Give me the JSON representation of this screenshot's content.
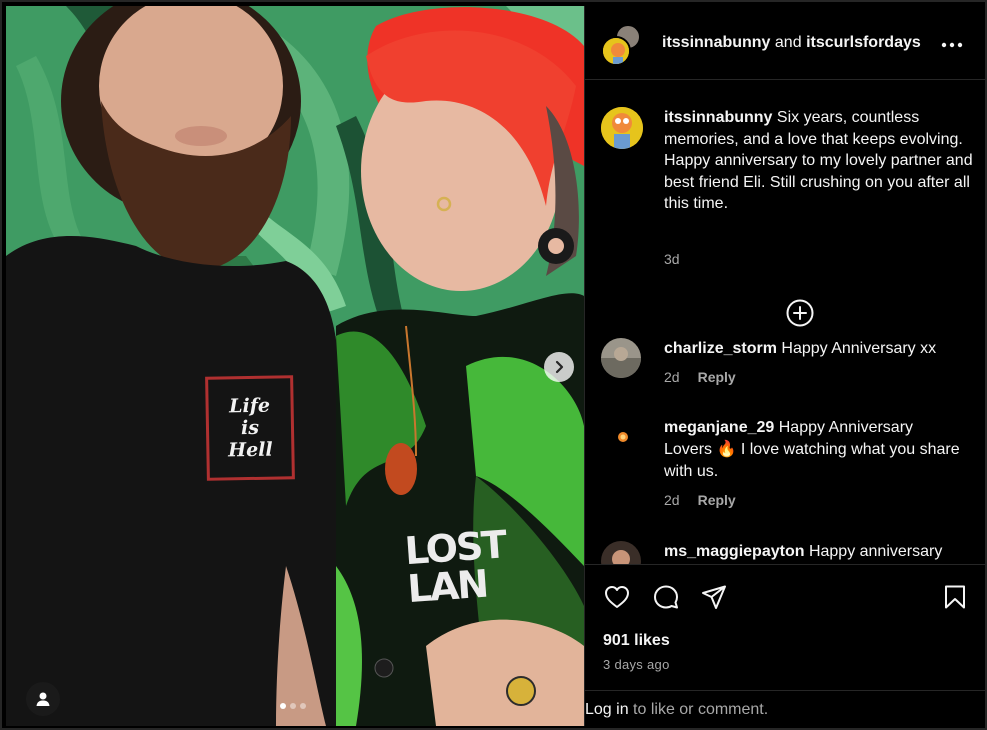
{
  "post": {
    "author": "itssinnabunny",
    "conjunction": "and",
    "collaborator": "itscurlsfordays",
    "more_icon": "more-horizontal-icon",
    "photo_shirt_text": [
      "Life",
      "is",
      "Hell"
    ],
    "photo_jersey_text": "LOST LAN",
    "carousel_count": 3,
    "carousel_active": 0
  },
  "caption": {
    "username": "itssinnabunny",
    "text": "Six years, countless memories, and a love that keeps evolving. Happy anniversary to my lovely partner and best friend Eli. Still crushing on you after all this time.",
    "time": "3d"
  },
  "comments": [
    {
      "username": "charlize_storm",
      "text": "Happy Anniversary xx",
      "time": "2d",
      "reply": "Reply"
    },
    {
      "username": "meganjane_29",
      "text_before": "Happy Anniversary Lovers",
      "emoji": "🔥",
      "text_after": "I love watching what you share with us.",
      "time": "2d",
      "reply": "Reply"
    },
    {
      "username": "ms_maggiepayton",
      "text": "Happy anniversary",
      "time": "",
      "reply": ""
    }
  ],
  "actions": {
    "like_icon": "heart-icon",
    "comment_icon": "comment-icon",
    "share_icon": "send-icon",
    "save_icon": "bookmark-icon",
    "likes": "901 likes",
    "posted": "3 days ago"
  },
  "login": {
    "link": "Log in",
    "rest": " to like or comment."
  },
  "colors": {
    "background": "#000000",
    "text": "#f5f5f5",
    "muted": "#a8a8a8",
    "divider": "#262626"
  }
}
